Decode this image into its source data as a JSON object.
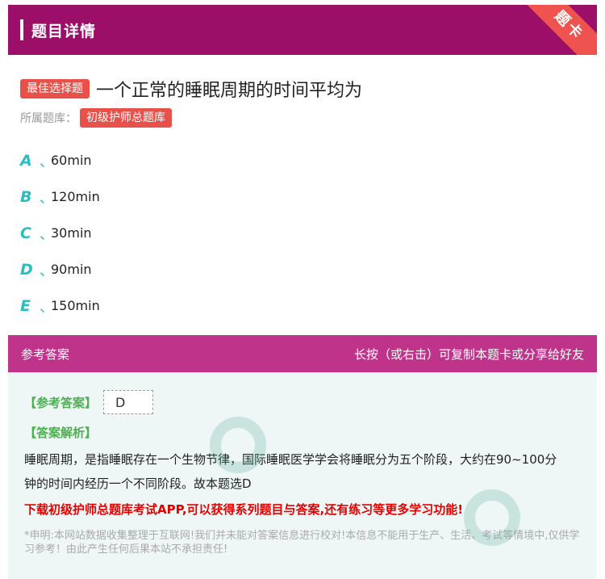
{
  "header": {
    "title": "题目详情",
    "ribbon": "题卡"
  },
  "question": {
    "type_tag": "最佳选择题",
    "text": "一个正常的睡眠周期的时间平均为",
    "library_label": "所属题库：",
    "library_name": "初级护师总题库"
  },
  "options": [
    {
      "letter": "A",
      "sep": "、",
      "text": "60min"
    },
    {
      "letter": "B",
      "sep": "、",
      "text": "120min"
    },
    {
      "letter": "C",
      "sep": "、",
      "text": "30min"
    },
    {
      "letter": "D",
      "sep": "、",
      "text": "90min"
    },
    {
      "letter": "E",
      "sep": "、",
      "text": "150min"
    }
  ],
  "answer_section": {
    "title": "参考答案",
    "hint": "长按（或右击）可复制本题卡或分享给好友",
    "answer_label": "【参考答案】",
    "answer_value": "D",
    "explain_label": "【答案解析】",
    "explain_text": "睡眠周期，是指睡眠存在一个生物节律，国际睡眠医学学会将睡眠分为五个阶段，大约在90~100分钟的时间内经历一个不同阶段。故本题选D",
    "promo": "下载初级护师总题库考试APP,可以获得系列题目与答案,还有练习等更多学习功能!",
    "disclaimer": "*申明:本网站数据收集整理于互联网!我们并未能对答案信息进行校对!本信息不能用于生产、生活、考试等情境中,仅供学习参考！由此产生任何后果本站不承担责任!"
  },
  "colors": {
    "header": "#9c0f68",
    "answer_header": "#c0338a",
    "tag": "#e8514a",
    "option_letter": "#2bbcc4",
    "answer_bg": "#eef7f6"
  }
}
